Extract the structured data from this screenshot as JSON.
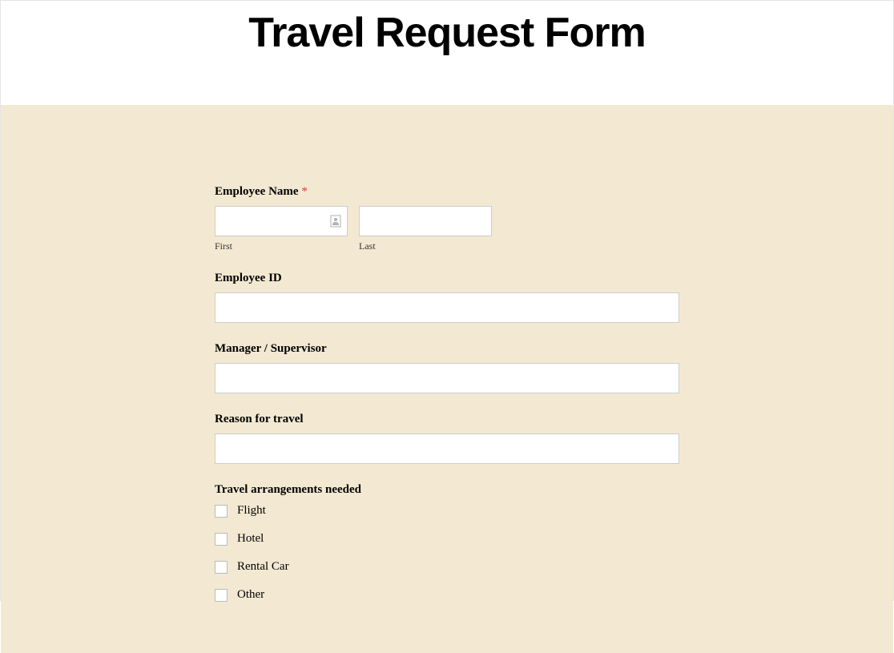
{
  "header": {
    "title": "Travel Request Form"
  },
  "form": {
    "employee_name": {
      "label": "Employee Name",
      "required_marker": "*",
      "first_sublabel": "First",
      "last_sublabel": "Last",
      "first_value": "",
      "last_value": ""
    },
    "employee_id": {
      "label": "Employee ID",
      "value": ""
    },
    "manager": {
      "label": "Manager / Supervisor",
      "value": ""
    },
    "reason": {
      "label": "Reason for travel",
      "value": ""
    },
    "arrangements": {
      "label": "Travel arrangements needed",
      "options": [
        {
          "label": "Flight"
        },
        {
          "label": "Hotel"
        },
        {
          "label": "Rental Car"
        },
        {
          "label": "Other"
        }
      ]
    }
  }
}
